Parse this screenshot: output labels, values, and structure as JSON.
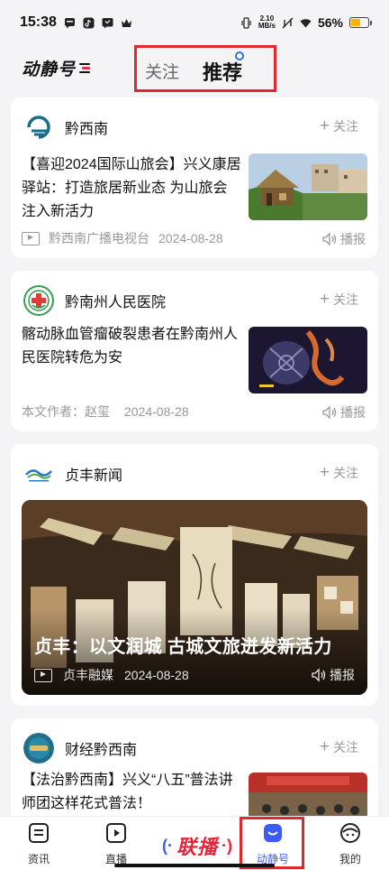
{
  "status_bar": {
    "time": "15:38",
    "netspeed_value": "2.10",
    "netspeed_unit": "MB/s",
    "battery_percent": "56%",
    "battery_level": 0.56
  },
  "top_nav": {
    "logo_text": "动静号",
    "tab_follow": "关注",
    "tab_recommend": "推荐"
  },
  "feed": [
    {
      "source": "黔西南",
      "follow_label": "关注",
      "title": "【喜迎2024国际山旅会】兴义康居驿站：打造旅居新业态 为山旅会注入新活力",
      "meta_source": "黔西南广播电视台",
      "date": "2024-08-28",
      "broadcast_label": "播报"
    },
    {
      "source": "黔南州人民医院",
      "follow_label": "关注",
      "title": "髂动脉血管瘤破裂患者在黔南州人民医院转危为安",
      "meta_author_label": "本文作者：",
      "meta_author": "赵玺",
      "date": "2024-08-28",
      "broadcast_label": "播报"
    },
    {
      "source": "贞丰新闻",
      "follow_label": "关注",
      "title": "贞丰：以文润城 古城文旅迸发新活力",
      "meta_source": "贞丰融媒",
      "date": "2024-08-28",
      "broadcast_label": "播报"
    },
    {
      "source": "财经黔西南",
      "follow_label": "关注",
      "title": "【法治黔西南】兴义“八五”普法讲师团这样花式普法！"
    }
  ],
  "bottom_nav": {
    "items": [
      {
        "label": "资讯"
      },
      {
        "label": "直播"
      },
      {
        "label": "动静号"
      },
      {
        "label": "我的"
      }
    ],
    "center_label": "联播"
  },
  "colors": {
    "accent_red": "#e0282e",
    "brand_blue": "#3b5cf5",
    "live_red": "#e8243b"
  }
}
